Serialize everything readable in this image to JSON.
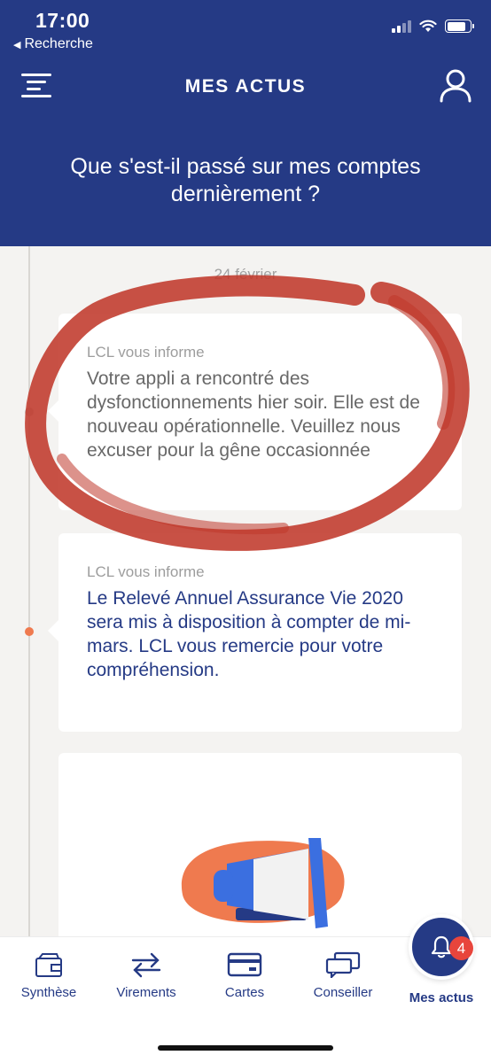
{
  "status_bar": {
    "time": "17:00",
    "back_label": "Recherche"
  },
  "header": {
    "title": "MES ACTUS",
    "headline": "Que s'est-il passé sur mes comptes dernièrement ?"
  },
  "feed": {
    "date": "24 février",
    "cards": [
      {
        "source": "LCL vous informe",
        "message": "Votre appli a rencontré des dysfonctionnements hier soir. Elle est de nouveau opérationnelle. Veuillez nous excuser pour la gêne occasionnée"
      },
      {
        "source": "LCL vous informe",
        "message": "Le Relevé Annuel Assurance Vie 2020 sera mis à disposition à compter de mi-mars. LCL vous remercie pour votre compréhension."
      }
    ]
  },
  "tabbar": {
    "tabs": [
      {
        "label": "Synthèse",
        "icon": "wallet-icon"
      },
      {
        "label": "Virements",
        "icon": "transfer-arrows-icon"
      },
      {
        "label": "Cartes",
        "icon": "card-icon"
      },
      {
        "label": "Conseiller",
        "icon": "chat-bubbles-icon"
      },
      {
        "label": "Mes actus",
        "icon": "bell-icon"
      }
    ],
    "notification_count": "4"
  },
  "colors": {
    "brand_blue": "#253a85",
    "accent_orange": "#ef7a4f",
    "badge_red": "#e8453c",
    "highlight_red": "#c0392b"
  }
}
